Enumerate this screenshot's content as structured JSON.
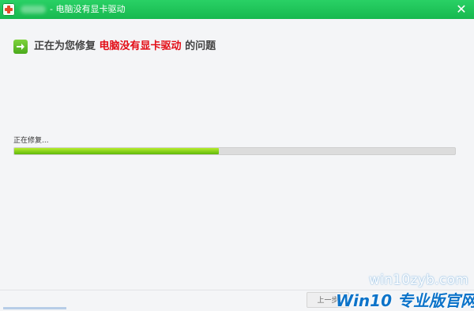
{
  "window": {
    "title": "- 电脑没有显卡驱动",
    "close_glyph": "✕"
  },
  "heading": {
    "prefix": "正在为您修复",
    "highlight": "电脑没有显卡驱动",
    "suffix": "的问题"
  },
  "status": {
    "text": "正在修复...",
    "progress_fraction": 0.465
  },
  "footer": {
    "back_label": "上一步"
  },
  "watermark": {
    "url": "win10zyb.com",
    "brand": "Win10 专业版官网"
  },
  "colors": {
    "titlebar": "#1fc55a",
    "highlight": "#e30d16",
    "progress": "#7cd019"
  }
}
